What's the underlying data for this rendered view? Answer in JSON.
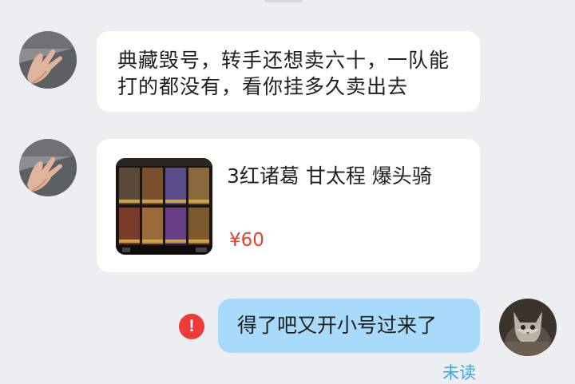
{
  "messages": [
    {
      "from": "other",
      "text": "典藏毁号，转手还想卖六十，一队能打的都没有，看你挂多久卖出去",
      "avatar_icon": "hand-gesture-avatar"
    },
    {
      "from": "other",
      "type": "product",
      "product": {
        "title": "3红诸葛 甘太程 爆头骑",
        "price": "¥60"
      },
      "avatar_icon": "hand-gesture-avatar"
    },
    {
      "from": "me",
      "text": "得了吧又开小号过来了",
      "status_icon": "error-icon",
      "status_symbol": "!",
      "read_status": "未读",
      "avatar_icon": "cat-avatar"
    }
  ],
  "colors": {
    "background": "#eceef2",
    "bubble_other": "#ffffff",
    "bubble_me": "#a8dbfb",
    "price": "#e4412e",
    "error": "#ef3a3a",
    "read_status": "#3aa6e6"
  }
}
